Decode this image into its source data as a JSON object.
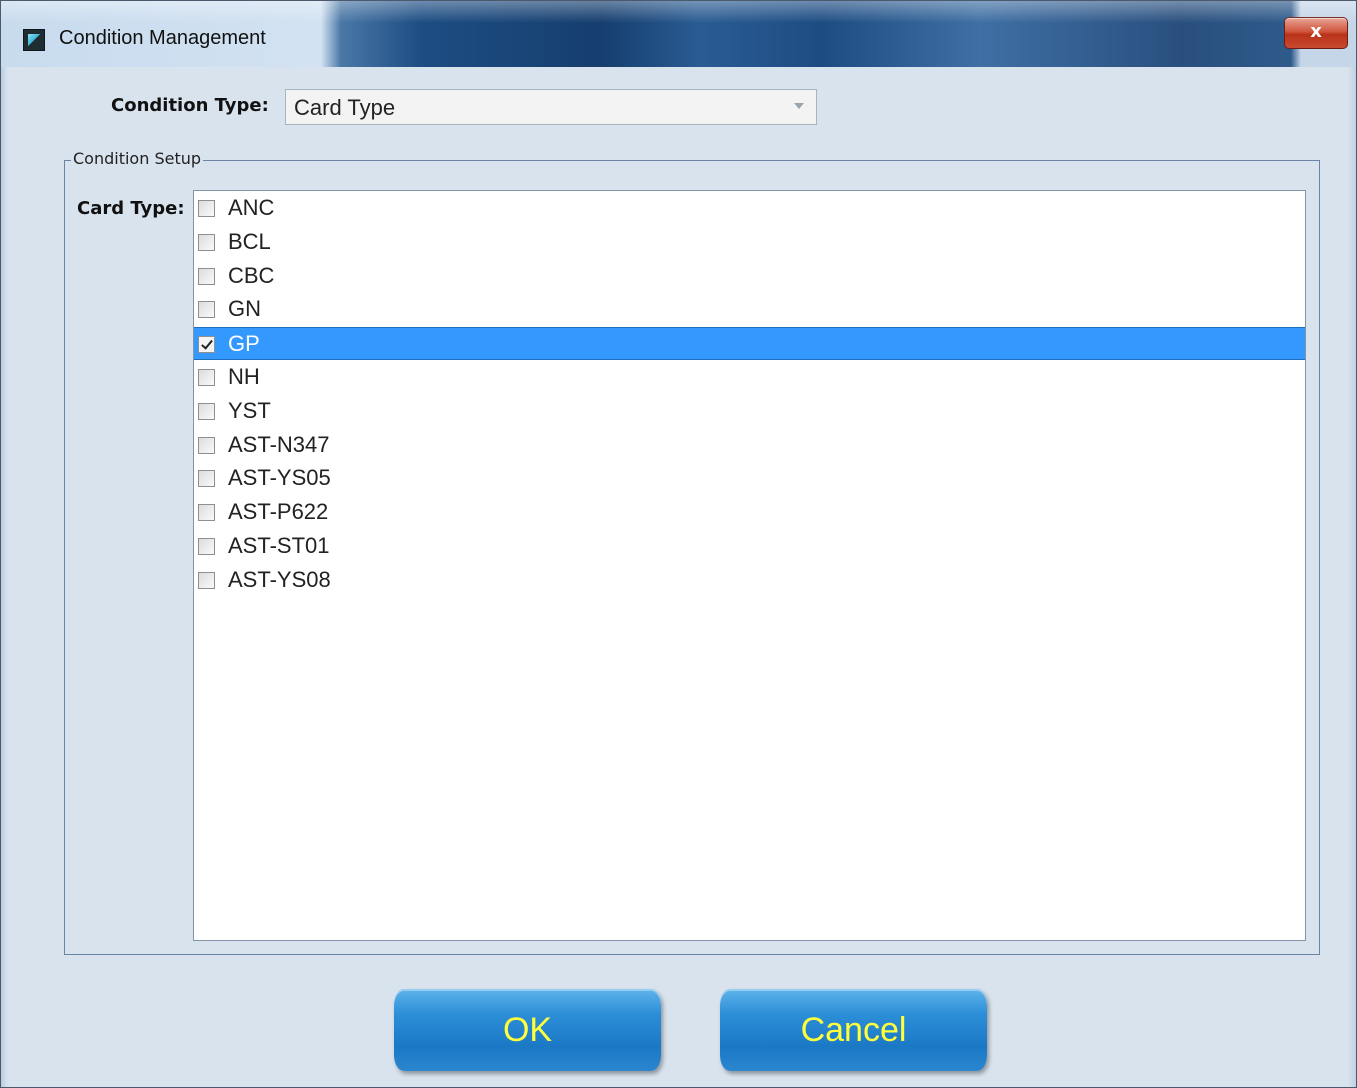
{
  "window": {
    "title": "Condition Management",
    "close_label": "x"
  },
  "condition_type": {
    "label": "Condition Type:",
    "selected_value": "Card Type"
  },
  "condition_setup": {
    "legend": "Condition Setup",
    "card_type_label": "Card Type:",
    "items": [
      {
        "label": "ANC",
        "checked": false,
        "selected": false
      },
      {
        "label": "BCL",
        "checked": false,
        "selected": false
      },
      {
        "label": "CBC",
        "checked": false,
        "selected": false
      },
      {
        "label": "GN",
        "checked": false,
        "selected": false
      },
      {
        "label": "GP",
        "checked": true,
        "selected": true
      },
      {
        "label": "NH",
        "checked": false,
        "selected": false
      },
      {
        "label": "YST",
        "checked": false,
        "selected": false
      },
      {
        "label": "AST-N347",
        "checked": false,
        "selected": false
      },
      {
        "label": "AST-YS05",
        "checked": false,
        "selected": false
      },
      {
        "label": "AST-P622",
        "checked": false,
        "selected": false
      },
      {
        "label": "AST-ST01",
        "checked": false,
        "selected": false
      },
      {
        "label": "AST-YS08",
        "checked": false,
        "selected": false
      }
    ]
  },
  "buttons": {
    "ok_label": "OK",
    "cancel_label": "Cancel"
  },
  "colors": {
    "selection": "#3399ff",
    "button_text": "#ffff3c",
    "button_face": "#2d8fd8"
  }
}
